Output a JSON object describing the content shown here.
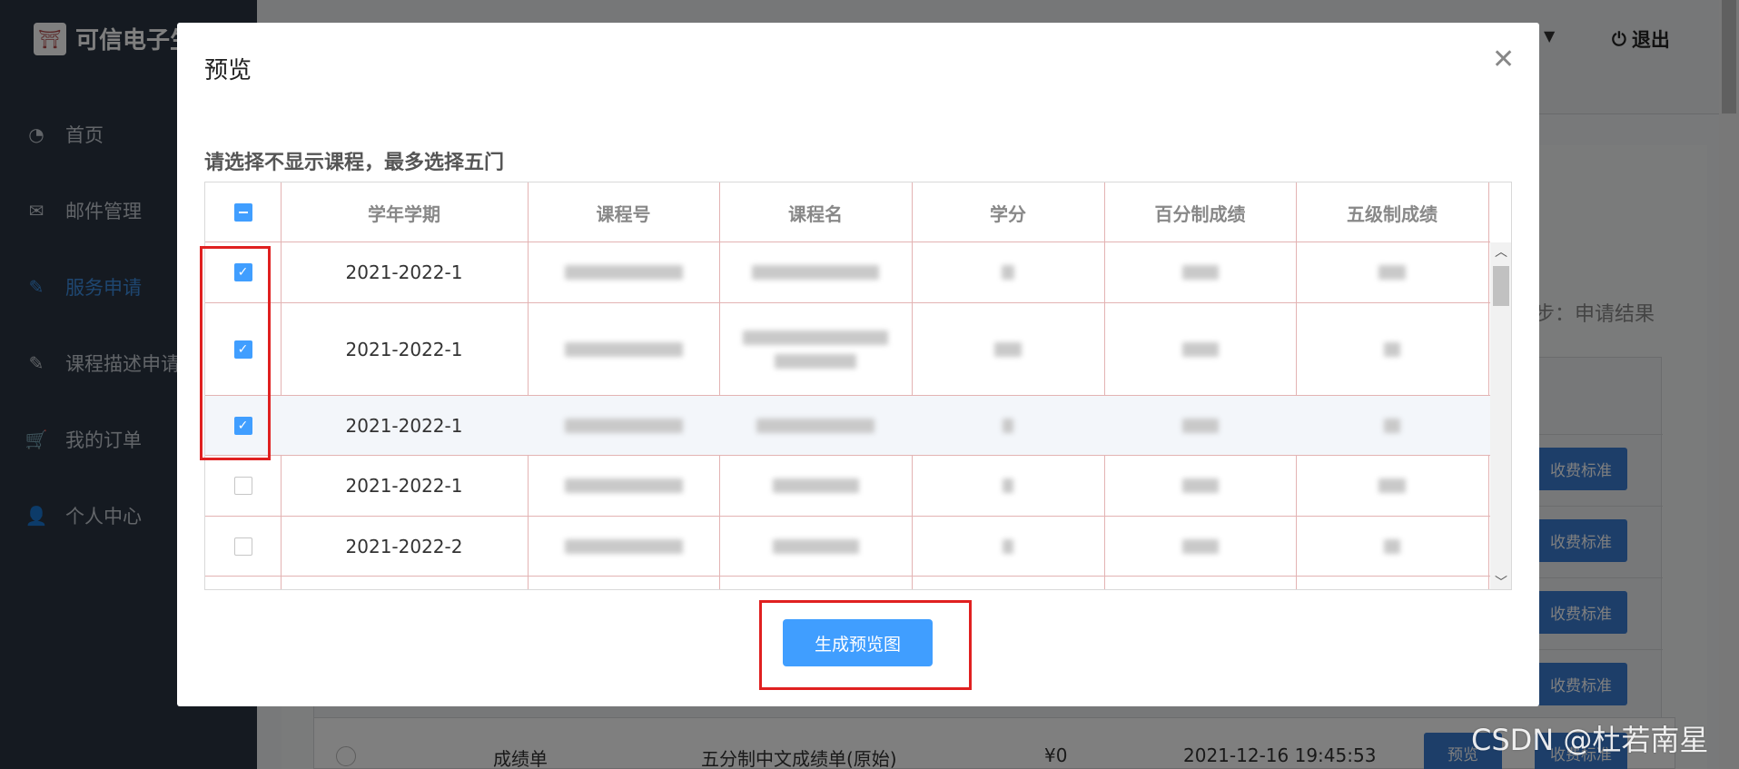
{
  "app": {
    "brand": "可信电子生"
  },
  "sidebar": {
    "items": [
      {
        "label": "首页",
        "icon": "dashboard-icon"
      },
      {
        "label": "邮件管理",
        "icon": "envelope-icon"
      },
      {
        "label": "服务申请",
        "icon": "edit-document-icon",
        "active": true
      },
      {
        "label": "课程描述申请",
        "icon": "edit-document-icon"
      },
      {
        "label": "我的订单",
        "icon": "cart-icon"
      },
      {
        "label": "个人中心",
        "icon": "user-icon"
      }
    ]
  },
  "header": {
    "logout": "退出"
  },
  "background": {
    "step": "步：申请结果",
    "fee_button": "收费标准",
    "last_row": {
      "col1": "成绩单",
      "col2": "五分制中文成绩单(原始)",
      "price": "¥0",
      "time": "2021-12-16 19:45:53",
      "preview": "预览",
      "fee": "收费标准"
    }
  },
  "modal": {
    "title": "预览",
    "subtitle": "请选择不显示课程，最多选择五门",
    "generate_button": "生成预览图",
    "columns": [
      "学年学期",
      "课程号",
      "课程名",
      "学分",
      "百分制成绩",
      "五级制成绩"
    ],
    "rows": [
      {
        "term": "2021-2022-1",
        "checked": true
      },
      {
        "term": "2021-2022-1",
        "checked": true
      },
      {
        "term": "2021-2022-1",
        "checked": true
      },
      {
        "term": "2021-2022-1",
        "checked": false
      },
      {
        "term": "2021-2022-2",
        "checked": false
      }
    ]
  },
  "watermark": "CSDN @杜若南星",
  "colors": {
    "primary": "#409eff",
    "annotation": "#e02020",
    "sidebar": "#2a3542"
  }
}
